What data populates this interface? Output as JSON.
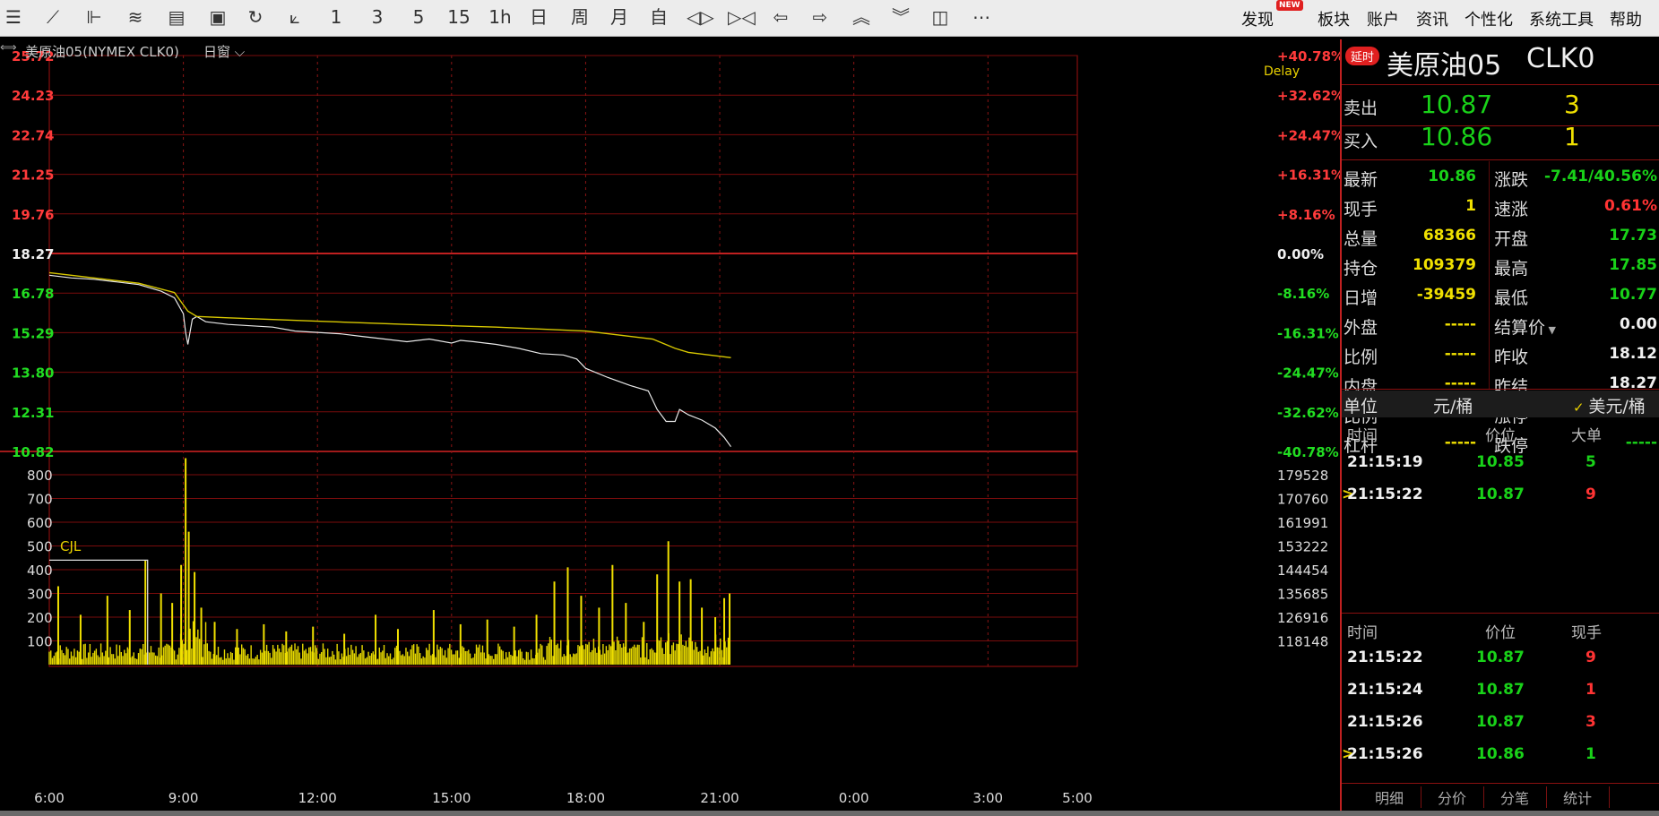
{
  "toolbar": {
    "icons": [
      "menu-icon",
      "line-chart-icon",
      "candlestick-icon",
      "indicator-icon",
      "chart-panel-icon",
      "save-icon",
      "refresh-icon",
      "draw-line-icon"
    ],
    "periods": [
      "1",
      "3",
      "5",
      "15",
      "1h",
      "日",
      "周",
      "月",
      "自"
    ],
    "nav_icons": [
      "collapse-icon",
      "expand-icon",
      "left-arrow-icon",
      "right-arrow-icon",
      "up-double-icon",
      "down-double-icon",
      "layout-icon",
      "more-icon"
    ],
    "menu": [
      "发现",
      "板块",
      "账户",
      "资讯",
      "个性化",
      "系统工具",
      "帮助"
    ],
    "new_badge": "NEW"
  },
  "subheader": {
    "name": "美原油05(NYMEX CLK0)",
    "window_mode": "日窗"
  },
  "chart_data": [
    {
      "type": "line",
      "name": "price",
      "delay_label": "Delay",
      "x_ticks": [
        "6:00",
        "9:00",
        "12:00",
        "15:00",
        "18:00",
        "21:00",
        "0:00",
        "3:00",
        "5:00"
      ],
      "left_ticks": [
        "25.72",
        "24.23",
        "22.74",
        "21.25",
        "19.76",
        "18.27",
        "16.78",
        "15.29",
        "13.80",
        "12.31",
        "10.82"
      ],
      "right_ticks": [
        "+40.78%",
        "+32.62%",
        "+24.47%",
        "+16.31%",
        "+8.16%",
        "0.00%",
        "-8.16%",
        "-16.31%",
        "-24.47%",
        "-32.62%",
        "-40.78%"
      ],
      "ylim": [
        10.82,
        25.72
      ],
      "reference": 18.27,
      "series": [
        {
          "role": "price",
          "color": "#e8e8e8",
          "x": [
            6.0,
            6.5,
            7.0,
            7.5,
            8.0,
            8.5,
            8.8,
            9.0,
            9.05,
            9.1,
            9.2,
            9.3,
            9.5,
            10.0,
            10.5,
            11.0,
            11.5,
            12.0,
            12.5,
            13.0,
            13.5,
            14.0,
            14.5,
            15.0,
            15.2,
            15.5,
            16.0,
            16.5,
            17.0,
            17.5,
            17.8,
            18.0,
            18.5,
            19.0,
            19.4,
            19.6,
            19.8,
            20.0,
            20.1,
            20.3,
            20.6,
            20.9,
            21.1,
            21.25
          ],
          "y": [
            17.45,
            17.35,
            17.3,
            17.2,
            17.1,
            16.85,
            16.6,
            16.0,
            15.3,
            14.85,
            15.8,
            15.9,
            15.7,
            15.6,
            15.55,
            15.5,
            15.35,
            15.3,
            15.25,
            15.15,
            15.05,
            14.95,
            15.05,
            14.9,
            15.0,
            14.95,
            14.85,
            14.7,
            14.5,
            14.45,
            14.3,
            13.95,
            13.6,
            13.3,
            13.1,
            12.4,
            11.95,
            11.95,
            12.4,
            12.2,
            12.0,
            11.7,
            11.35,
            11.0
          ]
        },
        {
          "role": "average",
          "color": "#d8c800",
          "x": [
            6.0,
            7.0,
            8.0,
            8.8,
            9.1,
            9.3,
            10.0,
            12.0,
            14.0,
            16.0,
            18.0,
            19.5,
            20.0,
            20.3,
            21.25
          ],
          "y": [
            17.55,
            17.35,
            17.15,
            16.8,
            16.1,
            15.9,
            15.85,
            15.72,
            15.6,
            15.5,
            15.35,
            15.05,
            14.7,
            14.55,
            14.35
          ]
        }
      ]
    },
    {
      "type": "bar",
      "name": "volume",
      "label": "CJL",
      "left_ticks": [
        "800",
        "700",
        "600",
        "500",
        "400",
        "300",
        "200",
        "100"
      ],
      "right_ticks": [
        "179528",
        "170760",
        "161991",
        "153222",
        "144454",
        "135685",
        "126916",
        "118148"
      ],
      "ylim": [
        0,
        880
      ],
      "open_interest_step": {
        "x_end": 8.2,
        "value": 440
      },
      "spikes": [
        {
          "x": 6.2,
          "v": 330
        },
        {
          "x": 6.7,
          "v": 210
        },
        {
          "x": 7.3,
          "v": 290
        },
        {
          "x": 7.8,
          "v": 230
        },
        {
          "x": 8.15,
          "v": 440
        },
        {
          "x": 8.5,
          "v": 300
        },
        {
          "x": 8.75,
          "v": 260
        },
        {
          "x": 8.95,
          "v": 420
        },
        {
          "x": 9.05,
          "v": 870
        },
        {
          "x": 9.12,
          "v": 560
        },
        {
          "x": 9.25,
          "v": 390
        },
        {
          "x": 9.4,
          "v": 240
        },
        {
          "x": 9.7,
          "v": 180
        },
        {
          "x": 10.2,
          "v": 150
        },
        {
          "x": 10.8,
          "v": 170
        },
        {
          "x": 11.3,
          "v": 140
        },
        {
          "x": 11.9,
          "v": 160
        },
        {
          "x": 12.6,
          "v": 130
        },
        {
          "x": 13.3,
          "v": 210
        },
        {
          "x": 13.8,
          "v": 150
        },
        {
          "x": 14.6,
          "v": 230
        },
        {
          "x": 15.2,
          "v": 170
        },
        {
          "x": 15.8,
          "v": 190
        },
        {
          "x": 16.4,
          "v": 160
        },
        {
          "x": 16.9,
          "v": 210
        },
        {
          "x": 17.3,
          "v": 350
        },
        {
          "x": 17.6,
          "v": 410
        },
        {
          "x": 17.9,
          "v": 290
        },
        {
          "x": 18.3,
          "v": 240
        },
        {
          "x": 18.6,
          "v": 420
        },
        {
          "x": 18.9,
          "v": 260
        },
        {
          "x": 19.3,
          "v": 180
        },
        {
          "x": 19.6,
          "v": 380
        },
        {
          "x": 19.85,
          "v": 520
        },
        {
          "x": 20.1,
          "v": 350
        },
        {
          "x": 20.35,
          "v": 360
        },
        {
          "x": 20.6,
          "v": 240
        },
        {
          "x": 20.9,
          "v": 200
        },
        {
          "x": 21.1,
          "v": 280
        },
        {
          "x": 21.22,
          "v": 300
        }
      ]
    }
  ],
  "quote": {
    "delay_badge": "延时",
    "title": "美原油05",
    "code": "CLK0",
    "sell_label": "卖出",
    "sell_price": "10.87",
    "sell_vol": "3",
    "buy_label": "买入",
    "buy_price": "10.86",
    "buy_vol": "1",
    "rows": [
      {
        "l1": "最新",
        "v1": "10.86",
        "c1": "green",
        "l2": "涨跌",
        "v2": "-7.41/40.56%",
        "c2": "green"
      },
      {
        "l1": "现手",
        "v1": "1",
        "c1": "yellow",
        "l2": "速涨",
        "v2": "0.61%",
        "c2": "red"
      },
      {
        "l1": "总量",
        "v1": "68366",
        "c1": "yellow",
        "l2": "开盘",
        "v2": "17.73",
        "c2": "green"
      },
      {
        "l1": "持仓",
        "v1": "109379",
        "c1": "yellow",
        "l2": "最高",
        "v2": "17.85",
        "c2": "green"
      },
      {
        "l1": "日增",
        "v1": "-39459",
        "c1": "yellow",
        "l2": "最低",
        "v2": "10.77",
        "c2": "green"
      },
      {
        "l1": "外盘",
        "v1": "-----",
        "c1": "yellow",
        "l2": "结算价",
        "v2": "0.00",
        "c2": "white"
      },
      {
        "l1": "比例",
        "v1": "-----",
        "c1": "yellow",
        "l2": "昨收",
        "v2": "18.12",
        "c2": "white"
      },
      {
        "l1": "内盘",
        "v1": "-----",
        "c1": "yellow",
        "l2": "昨结",
        "v2": "18.27",
        "c2": "white"
      },
      {
        "l1": "比例",
        "v1": "-----",
        "c1": "yellow",
        "l2": "涨停",
        "v2": "-----",
        "c2": "red"
      },
      {
        "l1": "杠杆",
        "v1": "-----",
        "c1": "yellow",
        "l2": "跌停",
        "v2": "-----",
        "c2": "green"
      }
    ],
    "unit_label": "单位",
    "unit_value": "元/桶",
    "unit_option": "美元/桶",
    "big_orders": {
      "headers": [
        "时间",
        "价位",
        "大单"
      ],
      "rows": [
        {
          "time": "21:15:19",
          "price": "10.85",
          "vol": "5",
          "vol_color": "green",
          "marker": ""
        },
        {
          "time": "21:15:22",
          "price": "10.87",
          "vol": "9",
          "vol_color": "red",
          "marker": ">"
        }
      ]
    },
    "ticks": {
      "headers": [
        "时间",
        "价位",
        "现手"
      ],
      "rows": [
        {
          "time": "21:15:22",
          "price": "10.87",
          "vol": "9",
          "vol_color": "red",
          "marker": ""
        },
        {
          "time": "21:15:24",
          "price": "10.87",
          "vol": "1",
          "vol_color": "red",
          "marker": ""
        },
        {
          "time": "21:15:26",
          "price": "10.87",
          "vol": "3",
          "vol_color": "red",
          "marker": ""
        },
        {
          "time": "21:15:26",
          "price": "10.86",
          "vol": "1",
          "vol_color": "green",
          "marker": ">"
        }
      ]
    },
    "tabs": [
      "明细",
      "分价",
      "分笔",
      "统计"
    ]
  }
}
